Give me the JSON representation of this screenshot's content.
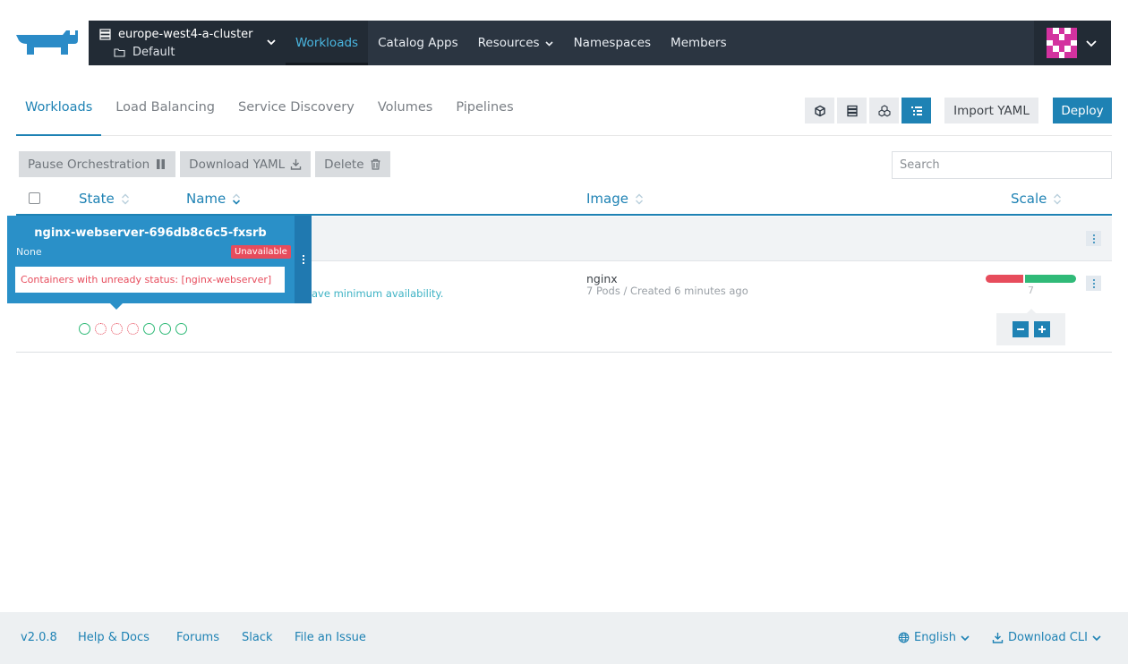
{
  "header": {
    "cluster_name": "europe-west4-a-cluster",
    "project_name": "Default",
    "nav": [
      {
        "label": "Workloads"
      },
      {
        "label": "Catalog Apps"
      },
      {
        "label": "Resources"
      },
      {
        "label": "Namespaces"
      },
      {
        "label": "Members"
      }
    ]
  },
  "tabs": [
    {
      "label": "Workloads"
    },
    {
      "label": "Load Balancing"
    },
    {
      "label": "Service Discovery"
    },
    {
      "label": "Volumes"
    },
    {
      "label": "Pipelines"
    }
  ],
  "actions": {
    "import_label": "Import YAML",
    "deploy_label": "Deploy"
  },
  "bulk": {
    "pause_label": "Pause Orchestration",
    "download_label": "Download YAML",
    "delete_label": "Delete"
  },
  "search": {
    "placeholder": "Search"
  },
  "table": {
    "columns": {
      "state": "State",
      "name": "Name",
      "image": "Image",
      "scale": "Scale"
    }
  },
  "workload": {
    "status_partial": "ave minimum availability.",
    "image": "nginx",
    "image_meta": "7 Pods / Created 6 minutes ago",
    "scale": "7",
    "pods_total": 7,
    "pods_unavailable": 3,
    "pod_states": [
      "ok",
      "bad",
      "bad",
      "bad",
      "ok",
      "ok",
      "ok"
    ]
  },
  "tooltip": {
    "pod_name": "nginx-webserver-696db8c6c5-fxsrb",
    "node": "None",
    "badge": "Unavailable",
    "message": "Containers with unready status: [nginx-webserver]"
  },
  "footer": {
    "version": "v2.0.8",
    "links": [
      "Help & Docs",
      "Forums",
      "Slack",
      "File an Issue"
    ],
    "language": "English",
    "download_cli": "Download CLI"
  },
  "colors": {
    "primary": "#1e82b4",
    "header_bg": "#2b3541",
    "error": "#e74c5c",
    "success": "#30ba78",
    "avatar": "#d3329f"
  },
  "icons": {
    "logo": "rancher-logo",
    "cluster": "server-icon",
    "project": "folder-icon"
  }
}
